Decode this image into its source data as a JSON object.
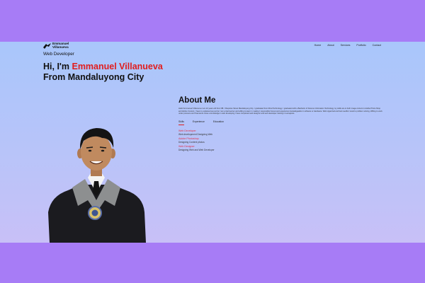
{
  "brand": {
    "name": "Emmanuel\nVillanueva",
    "logo_icon": "bird-logo-icon"
  },
  "nav": {
    "items": [
      "Home",
      "About",
      "Services",
      "Portfolio",
      "Contact"
    ]
  },
  "hero": {
    "role": "Web Developer",
    "greeting": "Hi, I'm ",
    "name": "Emmanuel Villanueva",
    "location": "From Mandaluyong City",
    "name_color": "#e11d1d"
  },
  "about": {
    "title": "About Me",
    "text": "Hello! Emmanuel Villanueva I am 22 years old from NB. I Requires Street Mandaluyong City. I graduated from Rizal Technology. I graduated with a Bachelor of Science Information Technology my skills are to both image content in Adobe Photo Shop and Adobe Content, I have to explained as just but I am a fast learner and willing to learn in making I responsible honest and experience knowledgeable in software or Hardware. Well organized and feel needful. Good to problem solving, Willing to work under pressure and Teamwork. Have a knowledge in web developing I have completed web designer and web developer training in Lamajores.",
    "tabs": [
      "Skills",
      "Experience",
      "Education"
    ],
    "active_tab": "Skills",
    "skills": [
      {
        "title": "Web Developer",
        "desc": "Web development Designing Web"
      },
      {
        "title": "Adobe Photoshop",
        "desc": "Designing Content photos"
      },
      {
        "title": "Web Designer",
        "desc": "Designing Web and Web Developer"
      }
    ]
  },
  "colors": {
    "accent": "#e11d1d",
    "frame": "#a77cf6"
  }
}
